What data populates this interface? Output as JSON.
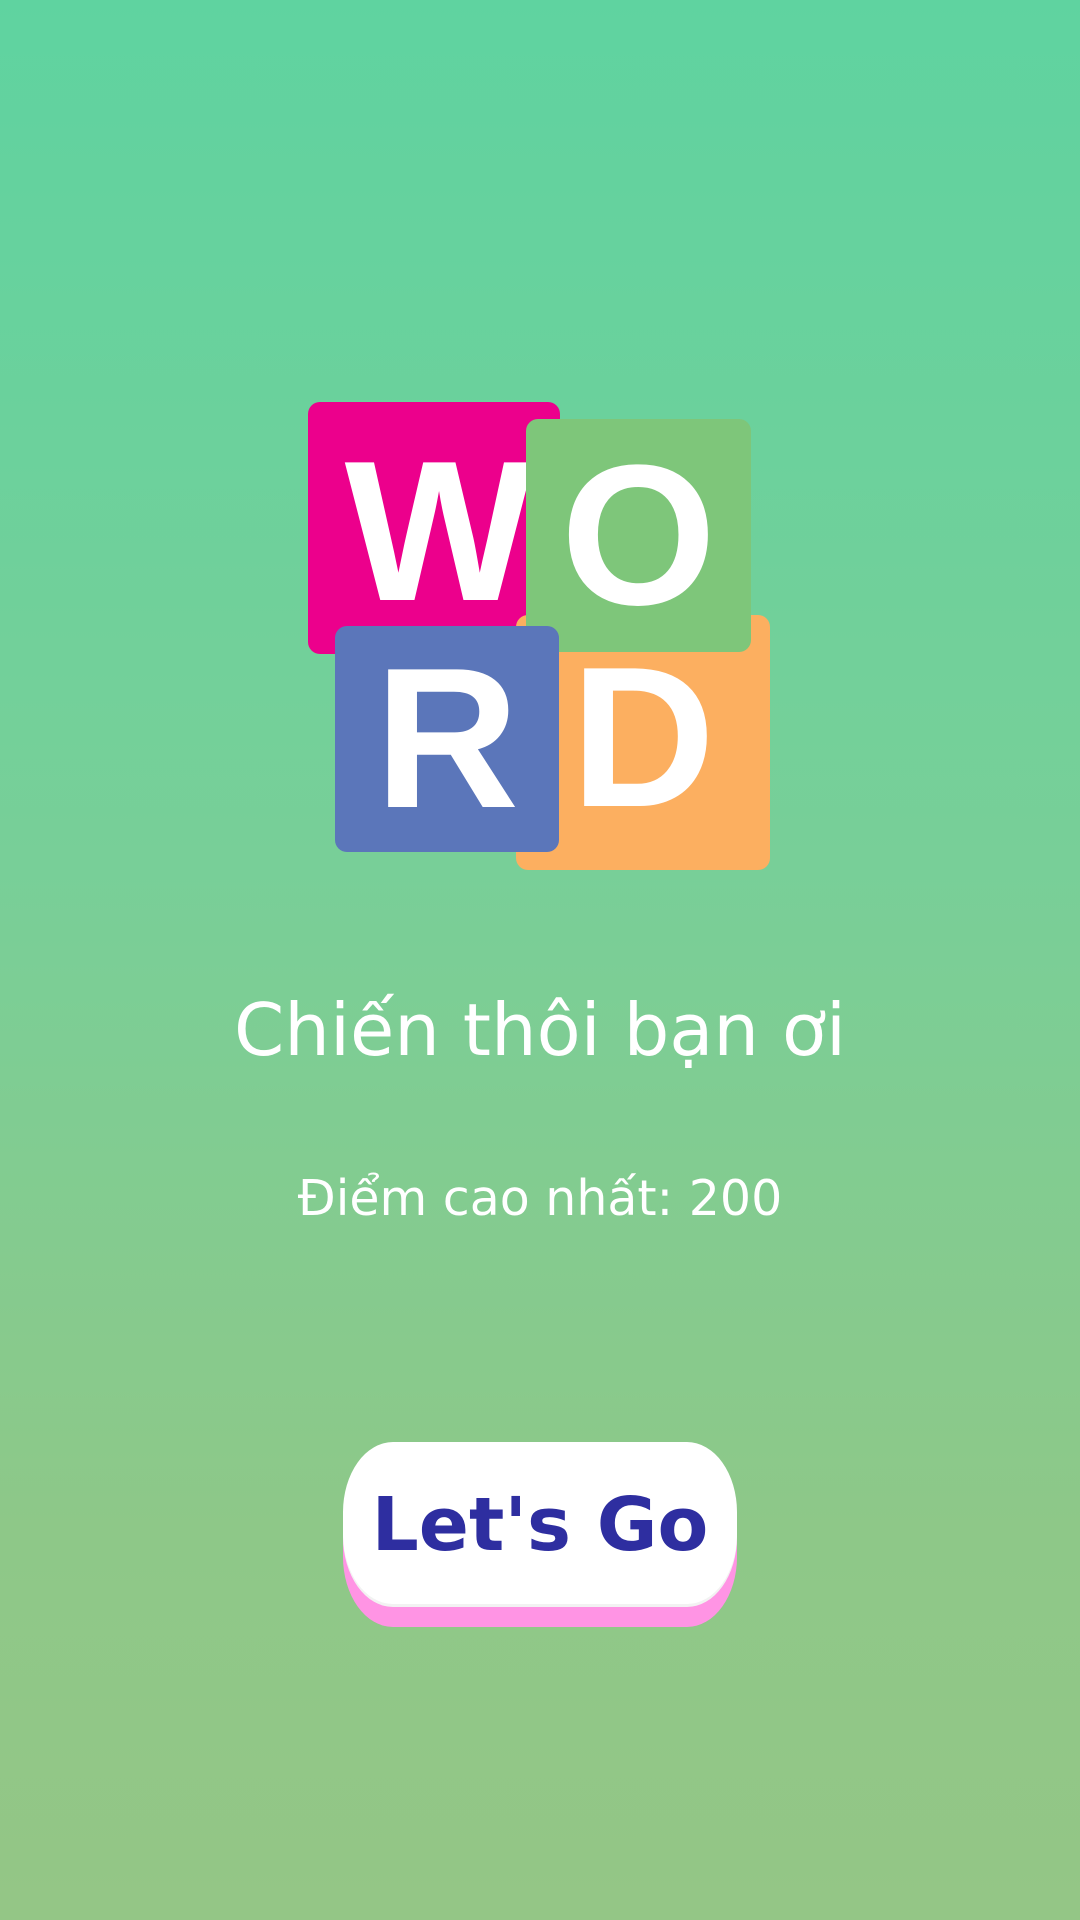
{
  "logo": {
    "letters": [
      "W",
      "O",
      "R",
      "D"
    ],
    "colors": {
      "w_tile": "#ec008c",
      "o_tile": "#7ec67a",
      "r_tile": "#5b76ba",
      "d_tile": "#fcaf60"
    }
  },
  "subtitle": "Chiến thôi bạn ơi",
  "highscore": "Điểm cao nhất: 200",
  "play_button": {
    "label": "Let's Go",
    "text_color": "#2e2ea0",
    "background": "#ffffff",
    "shadow_color": "#ff94e4"
  },
  "background": {
    "top_color": "#5fd3a0",
    "bottom_color": "#94c686"
  }
}
